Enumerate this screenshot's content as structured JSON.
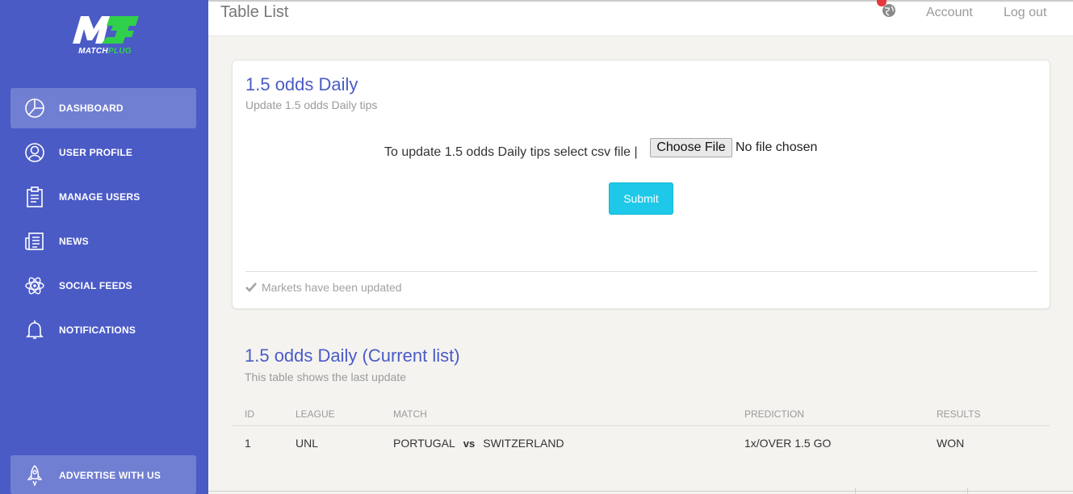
{
  "brand": {
    "name": "MATCHPLUG",
    "name_white": "MATCH",
    "name_green": "PLUG",
    "primary": "#4a5bc6",
    "accent_green": "#31d04a",
    "submit_color": "#1ec8e8"
  },
  "sidebar": {
    "items": [
      {
        "label": "DASHBOARD",
        "icon": "pie-chart-icon",
        "active": true
      },
      {
        "label": "USER PROFILE",
        "icon": "user-icon"
      },
      {
        "label": "MANAGE USERS",
        "icon": "clipboard-icon"
      },
      {
        "label": "NEWS",
        "icon": "newspaper-icon"
      },
      {
        "label": "SOCIAL FEEDS",
        "icon": "atom-icon"
      },
      {
        "label": "NOTIFICATIONS",
        "icon": "bell-icon"
      }
    ],
    "bottom_item": {
      "label": "ADVERTISE WITH US",
      "icon": "rocket-icon"
    }
  },
  "topbar": {
    "title": "Table List",
    "notification_icon": "globe-icon",
    "account_label": "Account",
    "logout_label": "Log out"
  },
  "upload_card": {
    "title": "1.5 odds Daily",
    "subtitle": "Update 1.5 odds Daily tips",
    "instruction": "To update 1.5 odds Daily tips select csv file |",
    "file_button_label": "Choose File",
    "file_status": "No file chosen",
    "submit_label": "Submit",
    "footer_text": "Markets have been updated"
  },
  "table_section": {
    "title": "1.5 odds Daily (Current list)",
    "subtitle": "This table shows the last update",
    "columns": [
      "ID",
      "LEAGUE",
      "MATCH",
      "PREDICTION",
      "RESULTS"
    ],
    "rows": [
      {
        "id": "1",
        "league": "UNL",
        "home": "PORTUGAL",
        "vs": "vs",
        "away": "SWITZERLAND",
        "prediction": "1x/OVER 1.5 GO",
        "result": "WON"
      }
    ]
  }
}
